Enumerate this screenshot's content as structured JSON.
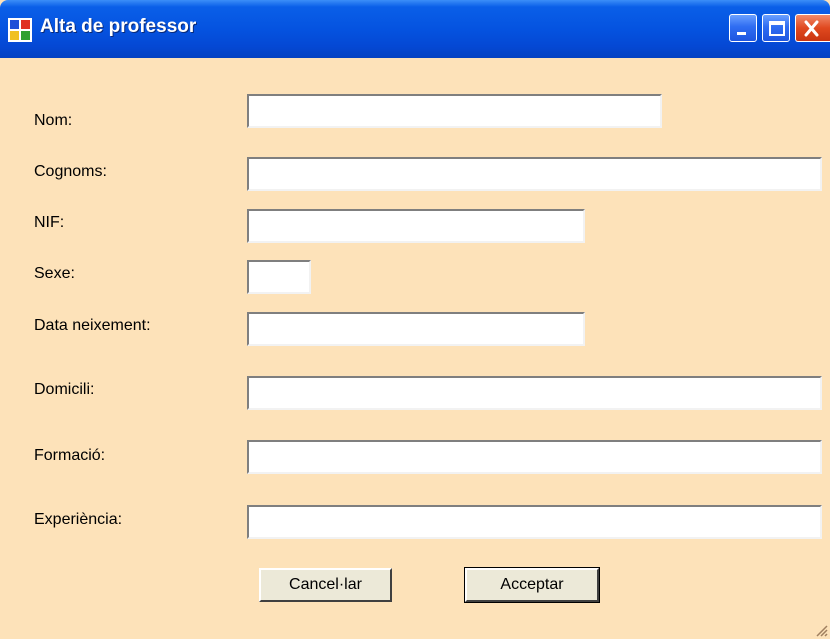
{
  "window": {
    "title": "Alta de professor"
  },
  "form": {
    "fields": [
      {
        "label": "Nom:",
        "value": ""
      },
      {
        "label": "Cognoms:",
        "value": ""
      },
      {
        "label": "NIF:",
        "value": ""
      },
      {
        "label": "Sexe:",
        "value": ""
      },
      {
        "label": "Data neixement:",
        "value": ""
      },
      {
        "label": "Domicili:",
        "value": ""
      },
      {
        "label": "Formació:",
        "value": ""
      },
      {
        "label": "Experiència:",
        "value": ""
      }
    ]
  },
  "buttons": {
    "cancel_label": "Cancel·lar",
    "accept_label": "Acceptar"
  },
  "colors": {
    "form_background": "#fde2b9",
    "titlebar": "#0553e0",
    "close_button": "#e0491f"
  },
  "icons": {
    "app": "windows-forms-app-icon",
    "minimize": "minimize-icon",
    "maximize": "maximize-icon",
    "close": "close-icon",
    "resize": "resize-grip-icon"
  }
}
